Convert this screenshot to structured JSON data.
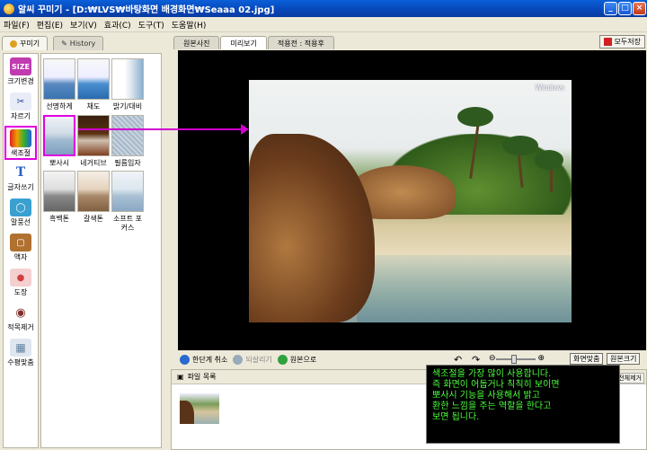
{
  "window": {
    "title": "알씨 꾸미기 - [D:₩LVS₩바탕화면  배경화면₩Seaaa 02.jpg]",
    "buttons": [
      "_",
      "□",
      "×"
    ]
  },
  "menu": [
    "파일(F)",
    "편집(E)",
    "보기(V)",
    "효과(C)",
    "도구(T)",
    "도움말(H)"
  ],
  "left_tabs": [
    {
      "label": "꾸미기",
      "icon": "decorate-icon"
    },
    {
      "label": "History",
      "icon": "pencil-icon"
    }
  ],
  "tools": [
    {
      "label": "크기변경",
      "icon": "size-icon",
      "glyph": "SIZE",
      "color": "#c03ab0"
    },
    {
      "label": "자르기",
      "icon": "scissors-icon",
      "glyph": "✂",
      "color": "#5068b8"
    },
    {
      "label": "색조절",
      "icon": "color-adjust-icon",
      "glyph": "▮▮▮",
      "color": "#e05030",
      "selected": true
    },
    {
      "label": "글자쓰기",
      "icon": "text-icon",
      "glyph": "T",
      "color": "#2a60c0"
    },
    {
      "label": "말풍선",
      "icon": "speech-bubble-icon",
      "glyph": "◯",
      "color": "#3aa0d0"
    },
    {
      "label": "액자",
      "icon": "frame-icon",
      "glyph": "▢",
      "color": "#b07030"
    },
    {
      "label": "도장",
      "icon": "stamp-icon",
      "glyph": "●",
      "color": "#d04040"
    },
    {
      "label": "적목제거",
      "icon": "red-eye-icon",
      "glyph": "◉",
      "color": "#804040"
    },
    {
      "label": "수평맞춤",
      "icon": "align-icon",
      "glyph": "▦",
      "color": "#6080a0"
    }
  ],
  "thumbnails": [
    {
      "label": "선명하게",
      "style": "sharp"
    },
    {
      "label": "채도",
      "style": "saturation"
    },
    {
      "label": "밝기/대비",
      "style": "brightness"
    },
    {
      "label": "뽀사시",
      "style": "soft",
      "selected": true
    },
    {
      "label": "네거티브",
      "style": "negative"
    },
    {
      "label": "필름입자",
      "style": "grain"
    },
    {
      "label": "흑백톤",
      "style": "mono"
    },
    {
      "label": "갈색톤",
      "style": "sepia"
    },
    {
      "label": "소프트 포커스",
      "style": "softfocus"
    }
  ],
  "view_tabs": [
    "원본사진",
    "미리보기",
    "적용전 : 적용후"
  ],
  "save_all": "모두저장",
  "photo_watermark": "Windows",
  "bottom_toolbar": {
    "undo": "한단계 취소",
    "redo": "되살리기",
    "original": "원본으로",
    "fit": "화면맞춤",
    "original_size": "원본크기",
    "zoom_level": 0.45
  },
  "file_list": {
    "title": "파일 목록",
    "clear": "전체제거"
  },
  "tooltip_lines": [
    "색조절을 가장 많이 사용합니다.",
    "즉 화면이 어둡거나 칙칙히 보이면",
    "뽀사시 기능을 사용해서 밝고",
    "환한 느낌을 주는 역할을 한다고",
    "보면 됩니다."
  ]
}
